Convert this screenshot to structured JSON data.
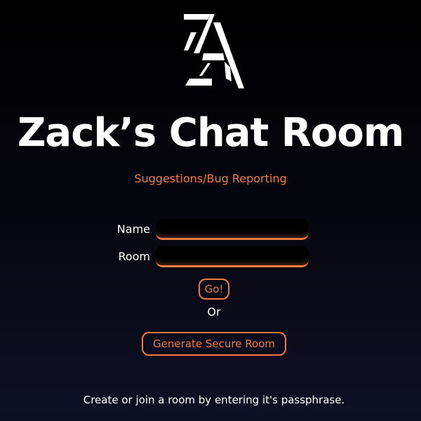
{
  "header": {
    "logo_icon": "za-logo-icon",
    "title": "Zack’s Chat Room",
    "suggestions_link": "Suggestions/Bug Reporting"
  },
  "form": {
    "name_label": "Name",
    "name_value": "",
    "room_label": "Room",
    "room_value": "",
    "go_label": "Go!",
    "or_text": "Or",
    "generate_label": "Generate Secure Room"
  },
  "footer": {
    "hint": "Create or join a room by entering it's passphrase."
  },
  "colors": {
    "accent": "#f07a42",
    "background": "#000000",
    "text": "#ffffff"
  }
}
